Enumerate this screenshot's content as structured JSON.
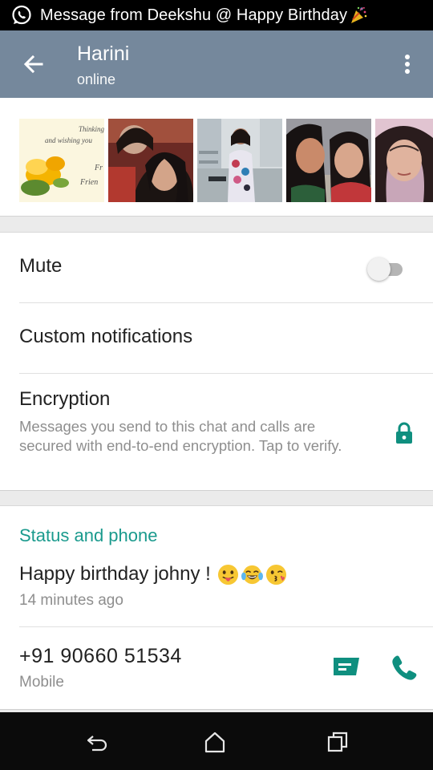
{
  "status_bar": {
    "notification": "Message from Deekshu @ Happy Birthday",
    "icons": [
      "whatsapp-icon",
      "party-popper-emoji"
    ]
  },
  "app_bar": {
    "title": "Harini",
    "subtitle": "online",
    "icons": [
      "back-arrow-icon",
      "more-vert-icon"
    ]
  },
  "media": {
    "thumbnails": [
      "media-photo-1",
      "media-photo-2",
      "media-photo-3",
      "media-photo-4",
      "media-photo-5"
    ],
    "card_text": "Thinking and wishing you Fr Frien"
  },
  "settings": {
    "mute_label": "Mute",
    "mute_enabled": false,
    "custom_notifications_label": "Custom notifications",
    "encryption_label": "Encryption",
    "encryption_desc": "Messages you send to this chat and calls are secured with end-to-end encryption. Tap to verify."
  },
  "status_phone": {
    "header": "Status and phone",
    "status_text": "Happy birthday johny !",
    "status_emojis": [
      "tongue-out-emoji",
      "tears-of-joy-emoji",
      "kiss-emoji"
    ],
    "status_time": "14 minutes ago",
    "phone": "+91 90660 51534",
    "phone_type": "Mobile"
  },
  "nav": {
    "icons": [
      "back-nav-icon",
      "home-nav-icon",
      "recents-nav-icon"
    ]
  },
  "colors": {
    "app_bar": "#75889c",
    "accent": "#1a9a8d",
    "icon_teal": "#0f8f7f"
  }
}
